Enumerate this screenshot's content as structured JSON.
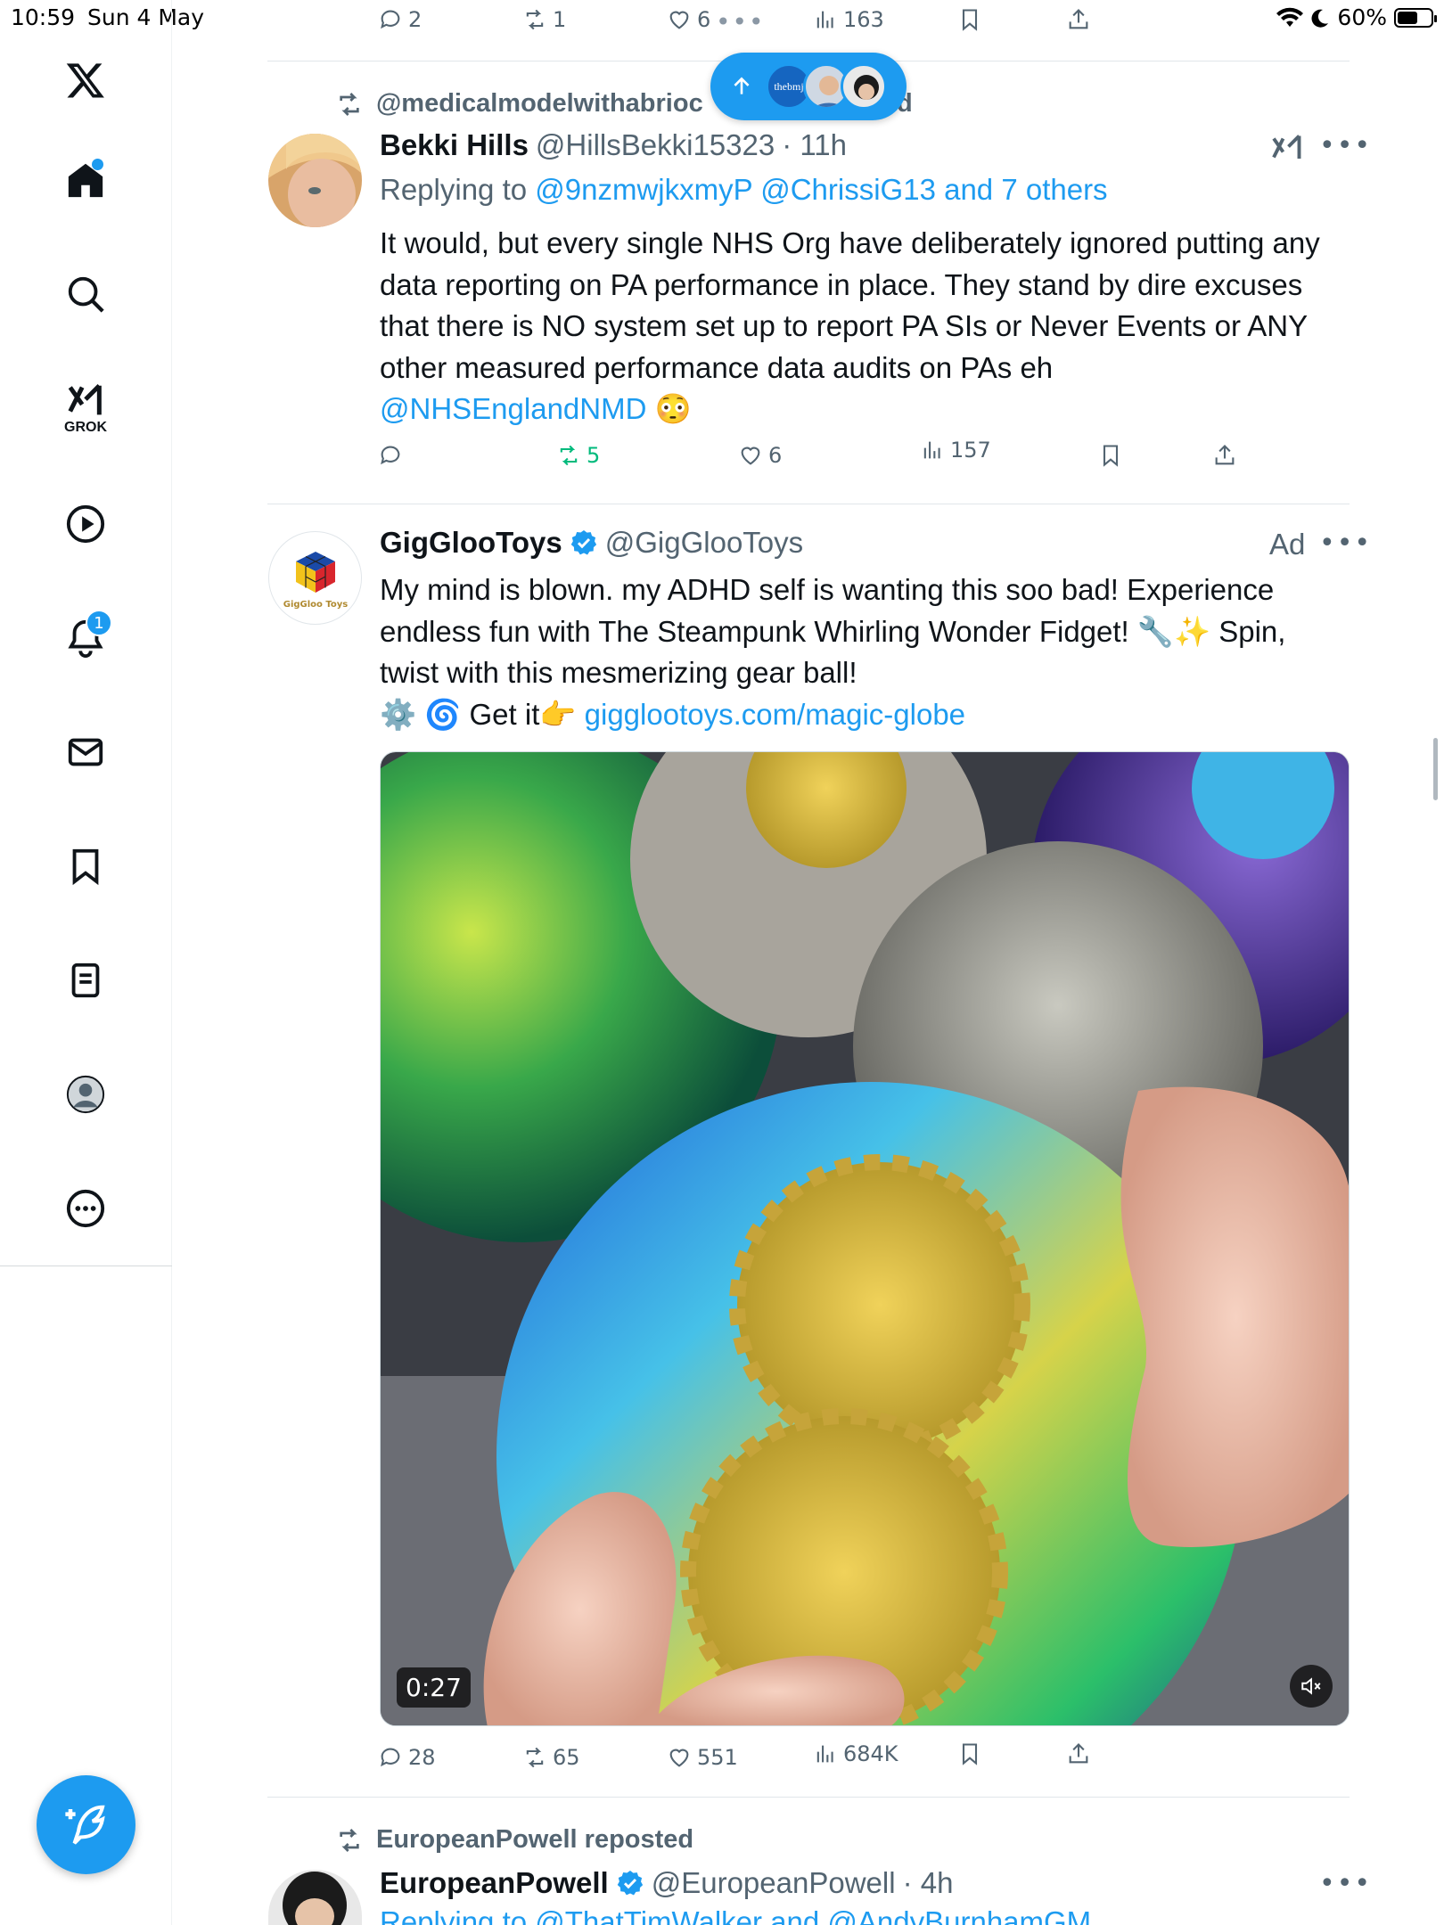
{
  "status_bar": {
    "time": "10:59",
    "date": "Sun 4 May",
    "battery": "60%",
    "battery_level": 0.6
  },
  "sidebar": {
    "grok_label": "GROK",
    "notifications_badge": "1",
    "icons": [
      "x-logo-icon",
      "home-icon",
      "search-icon",
      "grok-icon",
      "video-icon",
      "bell-icon",
      "mail-icon",
      "bookmark-icon",
      "lists-icon",
      "profile-icon",
      "more-icon"
    ]
  },
  "top_actions": {
    "replies": "2",
    "reposts": "1",
    "likes": "6",
    "views": "163"
  },
  "pill": {
    "logo_text": "thebmj"
  },
  "tweet1": {
    "repost_label": "@medicalmodelwithabrioc",
    "repost_suffix": "d",
    "name": "Bekki Hills",
    "handle": "@HillsBekki15323",
    "time": "· 11h",
    "reply_prefix": "Replying to",
    "reply_targets": "@9nzmwjkxmyP @ChrissiG13 and 7 others",
    "text": "It would, but every single NHS Org have deliberately ignored putting any data reporting on PA performance in place. They stand by dire excuses that there is NO system set up to report PA SIs or Never Events or ANY other measured performance data audits on PAs eh",
    "mention": "@NHSEnglandNMD",
    "emoji": "😳",
    "actions": {
      "replies": "",
      "reposts": "5",
      "likes": "6",
      "views": "157"
    }
  },
  "tweet2": {
    "name": "GigGlooToys",
    "handle": "@GigGlooToys",
    "ad_label": "Ad",
    "avatar_caption": "GigGloo Toys",
    "text_line1": "My mind is blown. my ADHD self is wanting this soo bad! Experience endless fun with The Steampunk Whirling Wonder Fidget! 🔧✨ Spin, twist with this mesmerizing gear ball!",
    "text_line2_prefix": "⚙️ 🌀 Get it👉",
    "link": "gigglootoys.com/magic-globe",
    "video_duration": "0:27",
    "actions": {
      "replies": "28",
      "reposts": "65",
      "likes": "551",
      "views": "684K"
    }
  },
  "tweet3": {
    "repost_label": "EuropeanPowell reposted",
    "name": "EuropeanPowell",
    "handle": "@EuropeanPowell",
    "time": "· 4h",
    "reply_partial": "Replying to @ThatTimWalker and @AndyBurnhamGM"
  },
  "colors": {
    "accent": "#1d9bf0",
    "retweet": "#00ba7c",
    "secondary_text": "#536471"
  }
}
